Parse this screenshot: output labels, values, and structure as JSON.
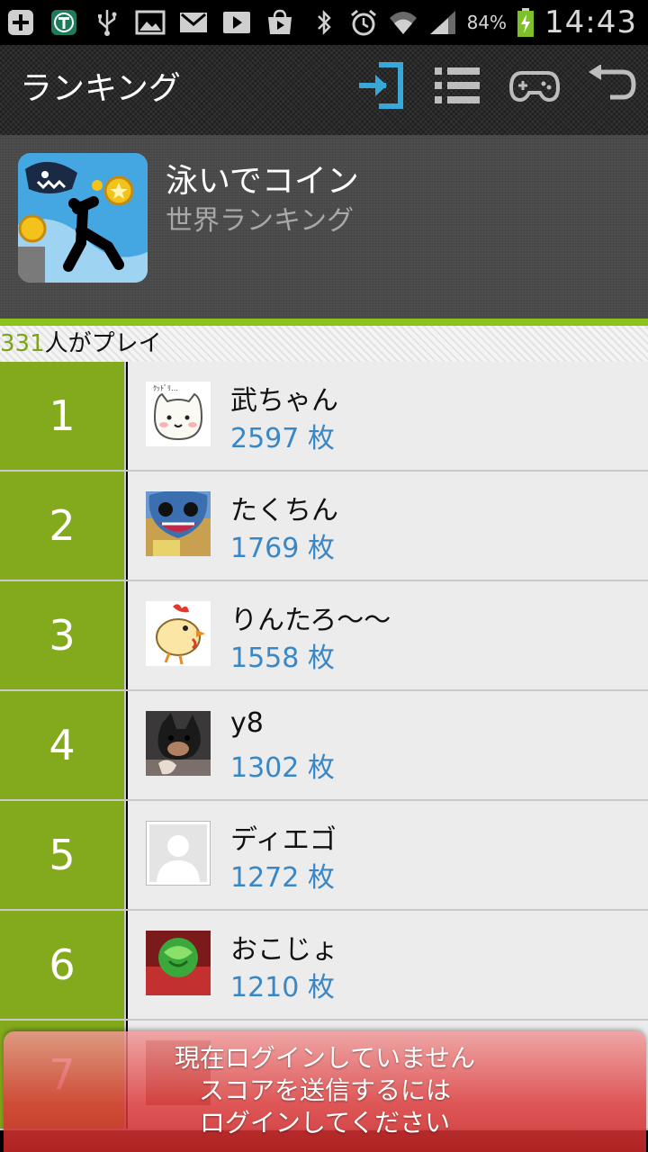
{
  "status_bar": {
    "battery_percent": "84%",
    "time": "14:43"
  },
  "action_bar": {
    "title": "ランキング",
    "actions": [
      "login-icon",
      "list-icon",
      "gamepad-icon",
      "back-icon"
    ]
  },
  "game": {
    "title": "泳いでコイン",
    "subtitle": "世界ランキング"
  },
  "players": {
    "count": "331",
    "label": "人がプレイ"
  },
  "ranking": [
    {
      "rank": "1",
      "name": "武ちゃん",
      "score": "2597 枚",
      "avatar": "cat-avatar"
    },
    {
      "rank": "2",
      "name": "たくちん",
      "score": "1769 枚",
      "avatar": "stitch-avatar"
    },
    {
      "rank": "3",
      "name": "りんたろ～～",
      "score": "1558 枚",
      "avatar": "chicken-avatar"
    },
    {
      "rank": "4",
      "name": "y8",
      "score": "1302 枚",
      "avatar": "dog-avatar"
    },
    {
      "rank": "5",
      "name": "ディエゴ",
      "score": "1272 枚",
      "avatar": "default-user-avatar"
    },
    {
      "rank": "6",
      "name": "おこじょ",
      "score": "1210 枚",
      "avatar": "green-ball-avatar"
    },
    {
      "rank": "7",
      "name": "",
      "score": "",
      "avatar": "avatar"
    }
  ],
  "toast": {
    "line1": "現在ログインしていません",
    "line2": "スコアを送信するには",
    "line3": "ログインしてください"
  },
  "colors": {
    "accent_green": "#83aa1c",
    "score_blue": "#3a87c5",
    "toast_red": "#dc3c3c"
  }
}
